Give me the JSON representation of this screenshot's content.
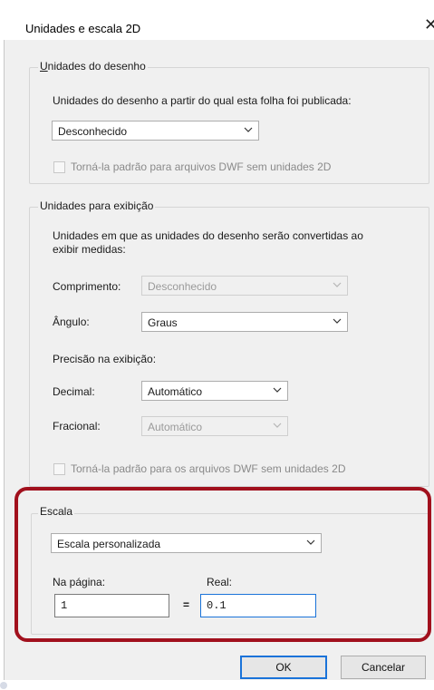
{
  "window": {
    "title": "Unidades e escala 2D",
    "close_glyph": "✕"
  },
  "drawing_units": {
    "legend": "Unidades do desenho",
    "description": "Unidades do desenho a partir do qual esta folha foi publicada:",
    "select_value": "Desconhecido",
    "default_checkbox_label": "Torná-la padrão para arquivos DWF sem unidades 2D",
    "default_checkbox_checked": false
  },
  "display_units": {
    "legend": "Unidades para exibição",
    "description_line1": "Unidades em que as unidades do desenho serão convertidas ao",
    "description_line2": "exibir medidas:",
    "length_label": "Comprimento:",
    "length_value": "Desconhecido",
    "angle_label": "Ângulo:",
    "angle_value": "Graus",
    "precision_label": "Precisão na exibição:",
    "decimal_label": "Decimal:",
    "decimal_value": "Automático",
    "fractional_label": "Fracional:",
    "fractional_value": "Automático",
    "default_checkbox_label": "Torná-la padrão para os arquivos DWF sem unidades 2D",
    "default_checkbox_checked": false
  },
  "scale": {
    "legend": "Escala",
    "select_value": "Escala personalizada",
    "page_label": "Na página:",
    "real_label": "Real:",
    "page_value": "1",
    "equals": "=",
    "real_value": "0.1"
  },
  "buttons": {
    "ok": "OK",
    "cancel": "Cancelar"
  },
  "colors": {
    "highlight": "#a1101d",
    "focus": "#1a73d9"
  }
}
